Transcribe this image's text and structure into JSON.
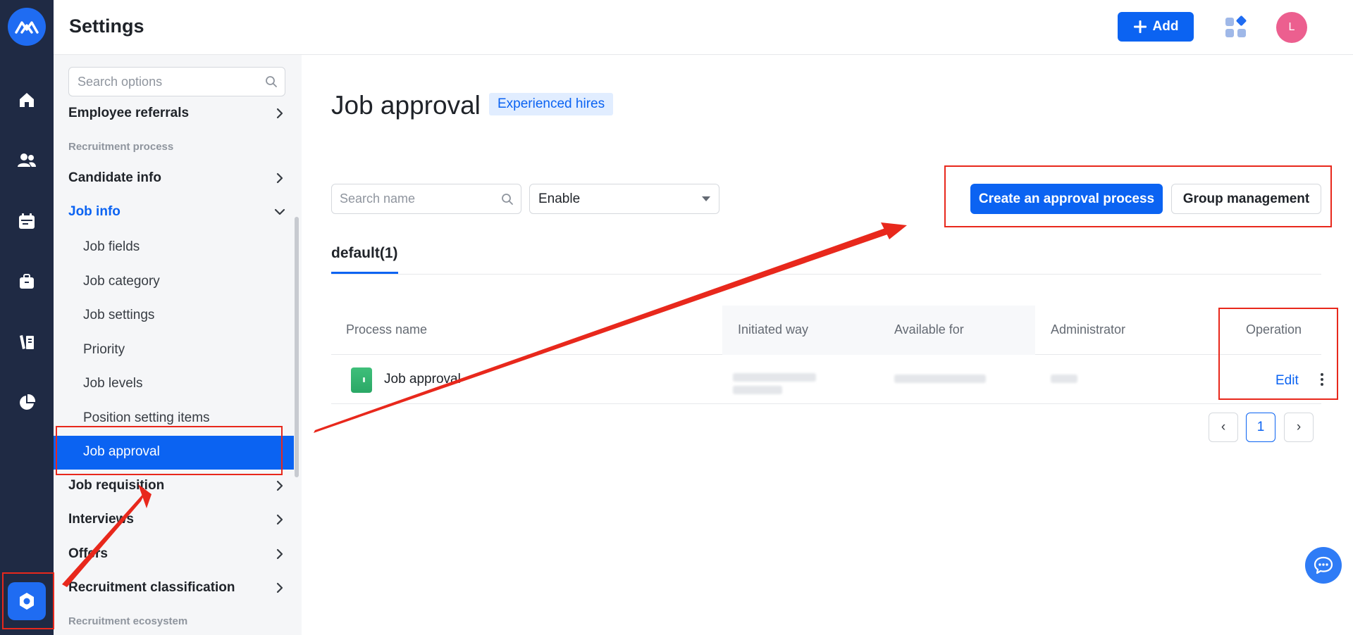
{
  "header": {
    "title": "Settings",
    "add_label": "Add",
    "avatar_initial": "L"
  },
  "rail": {
    "icons": [
      "home-icon",
      "people-icon",
      "calendar-icon",
      "briefcase-icon",
      "library-icon",
      "pie-chart-icon",
      "settings-icon"
    ]
  },
  "sidebar": {
    "search_placeholder": "Search options",
    "items": [
      {
        "label": "Employee referrals"
      },
      {
        "group": "Recruitment process"
      },
      {
        "label": "Candidate info"
      },
      {
        "label": "Job info"
      },
      {
        "label": "Job requisition"
      },
      {
        "label": "Interviews"
      },
      {
        "label": "Offers"
      },
      {
        "label": "Recruitment classification"
      },
      {
        "group": "Recruitment ecosystem"
      }
    ],
    "job_info_children": [
      "Job fields",
      "Job category",
      "Job settings",
      "Priority",
      "Job levels",
      "Position setting items",
      "Job approval"
    ]
  },
  "main": {
    "page_title": "Job approval",
    "tag": "Experienced hires",
    "search_placeholder": "Search name",
    "status_select": "Enable",
    "create_button": "Create an approval process",
    "group_button": "Group management",
    "tab": "default(1)",
    "columns": [
      "Process name",
      "Initiated way",
      "Available for",
      "Administrator",
      "Operation"
    ],
    "rows": [
      {
        "process_name": "Job approval",
        "edit": "Edit"
      }
    ],
    "pagination": {
      "current": "1",
      "prev": "‹",
      "next": "›"
    }
  },
  "colors": {
    "primary": "#0b63f2",
    "rail": "#1f2a44",
    "annotation": "#e8281c"
  }
}
